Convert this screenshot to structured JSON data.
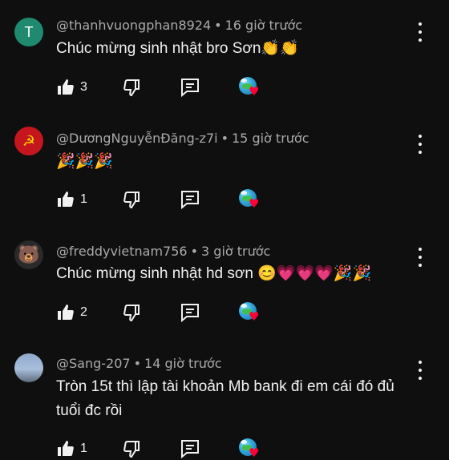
{
  "comments": [
    {
      "avatar_letter": "T",
      "author": "@thanhvuongphan8924",
      "time": "16 giờ trước",
      "text": "Chúc mừng sinh nhật bro Sơn👏👏",
      "likes": "3"
    },
    {
      "avatar_letter": "☭",
      "author": "@DươngNguyễnĐăng-z7i",
      "time": "15 giờ trước",
      "text": "🎉🎉🎉",
      "likes": "1"
    },
    {
      "avatar_letter": "🐻",
      "author": "@freddyvietnam756",
      "time": "3 giờ trước",
      "text": "Chúc mừng sinh nhật hd sơn 😊💗💗💗🎉🎉",
      "likes": "2"
    },
    {
      "avatar_letter": "",
      "author": "@Sang-207",
      "time": "14 giờ trước",
      "text": "Tròn 15t thì lập tài khoản Mb bank đi em cái đó đủ tuổi đc rồi",
      "likes": "1"
    }
  ],
  "separator": "•",
  "icons": {
    "like": "thumbs-up-icon",
    "dislike": "thumbs-down-icon",
    "reply": "reply-icon",
    "creator_heart": "creator-heart-icon",
    "menu": "more-vert-icon"
  },
  "colors": {
    "background": "#0f0f0f",
    "text": "#f1f1f1",
    "meta": "#aaaaaa",
    "heart": "#ff0033"
  }
}
